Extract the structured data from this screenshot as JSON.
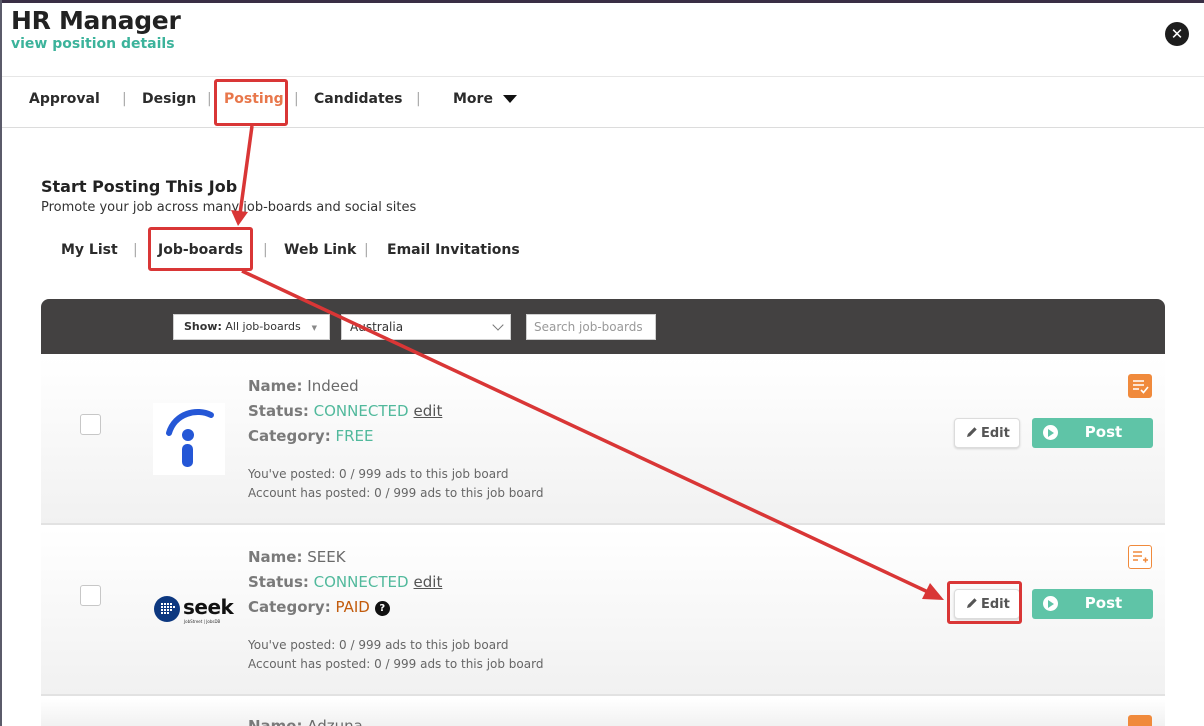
{
  "app": {
    "title": "HR Manager",
    "subtitle_link": "view position details",
    "close_symbol": "✕"
  },
  "nav": {
    "items": [
      {
        "label": "Approval"
      },
      {
        "label": "Design"
      },
      {
        "label": "Posting",
        "active": true
      },
      {
        "label": "Candidates"
      },
      {
        "label": "More"
      }
    ]
  },
  "posting": {
    "title": "Start Posting This Job",
    "subtitle": "Promote your job across many job-boards and social sites",
    "tabs": [
      {
        "label": "My List"
      },
      {
        "label": "Job-boards",
        "active": true
      },
      {
        "label": "Web Link"
      },
      {
        "label": "Email Invitations"
      }
    ]
  },
  "filters": {
    "show_label": "Show:",
    "show_value": "All job-boards",
    "country_value": "Australia",
    "search_placeholder": "Search job-boards"
  },
  "labels": {
    "name": "Name:",
    "status": "Status:",
    "category": "Category:",
    "edit_link": "edit",
    "edit_button": "Edit",
    "post_button": "Post"
  },
  "boards": [
    {
      "name": "Indeed",
      "status": "CONNECTED",
      "category": "FREE",
      "posted_self": "You've posted: 0 / 999 ads to this job board",
      "posted_account": "Account has posted: 0 / 999 ads to this job board",
      "logo_icon": "indeed-logo",
      "list_icon": "list-check-icon"
    },
    {
      "name": "SEEK",
      "status": "CONNECTED",
      "category": "PAID",
      "posted_self": "You've posted: 0 / 999 ads to this job board",
      "posted_account": "Account has posted: 0 / 999 ads to this job board",
      "logo_text": "seek",
      "logo_subtext": "JobStreet | JobsDB",
      "list_icon": "list-add-icon"
    },
    {
      "name": "Adzuna"
    }
  ],
  "colors": {
    "accent_green": "#3cb39b",
    "active_orange": "#e8774b",
    "highlight_red": "#d93636",
    "post_green": "#5fc4a7"
  }
}
